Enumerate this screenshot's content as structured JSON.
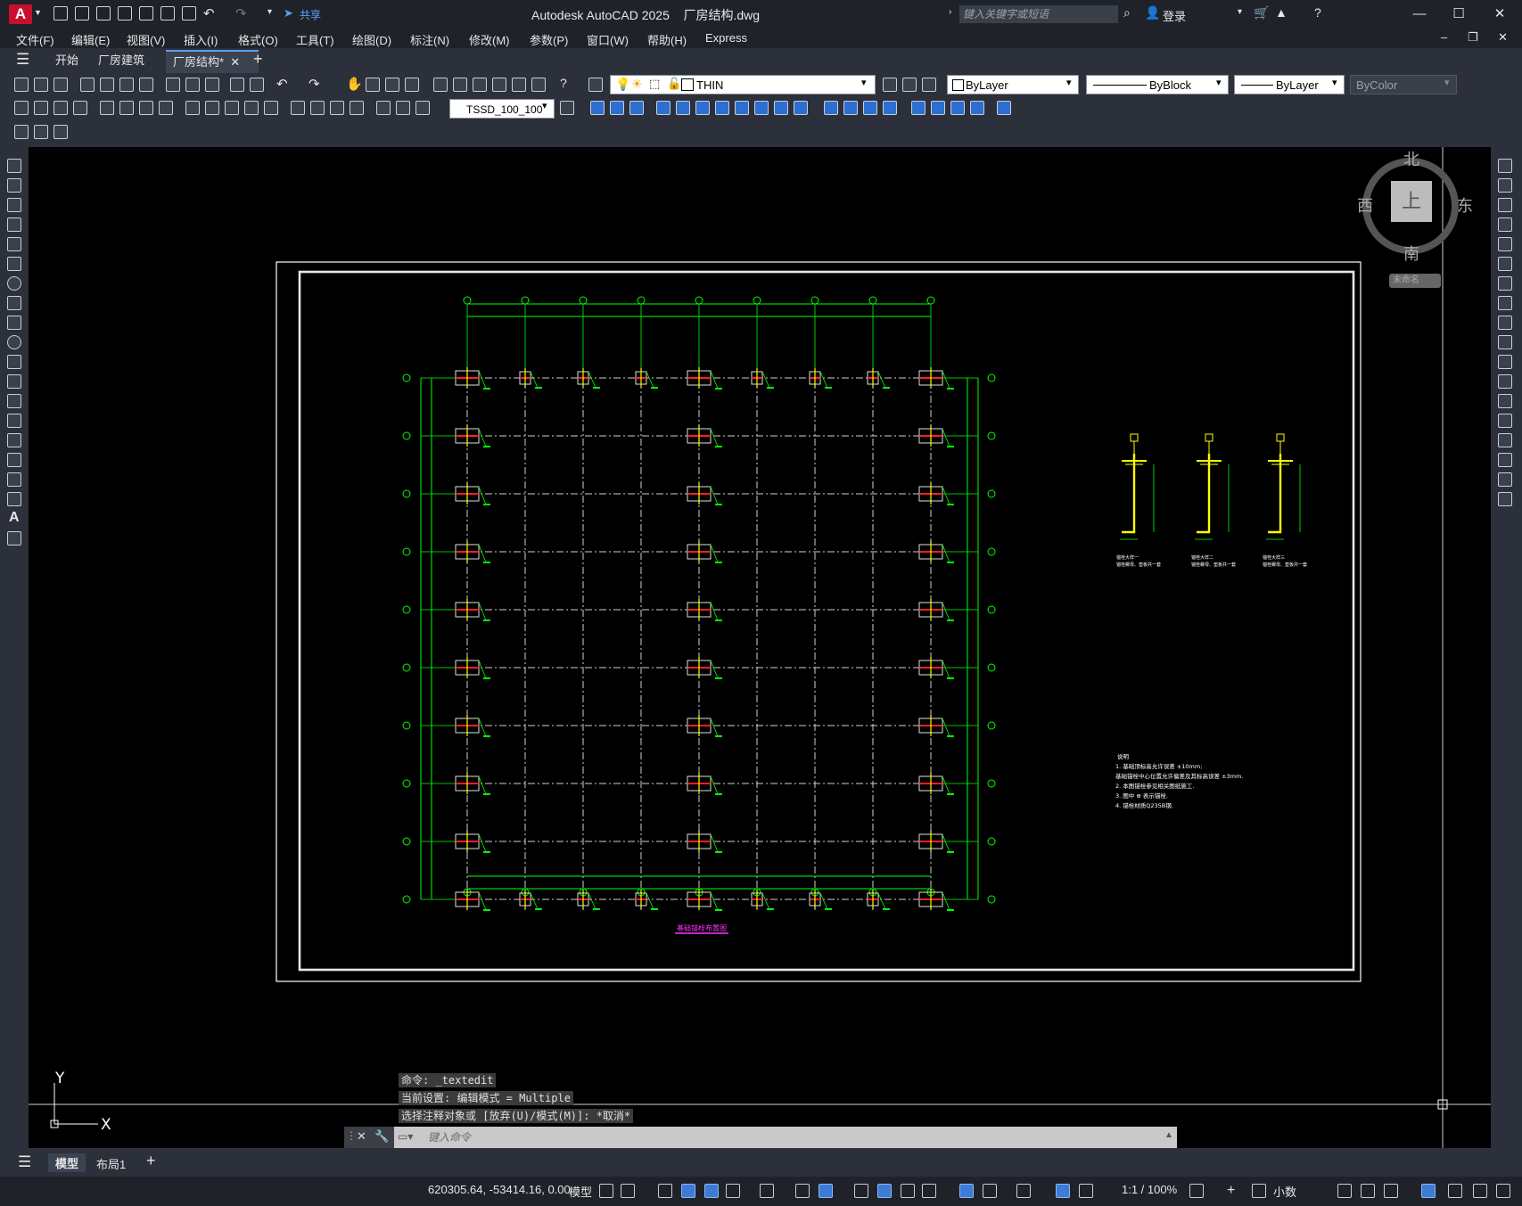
{
  "titlebar": {
    "app_logo": "A",
    "share_label": "共享",
    "title": "Autodesk AutoCAD 2025",
    "filename": "厂房结构.dwg",
    "search_placeholder": "键入关键字或短语",
    "login_label": "登录"
  },
  "menu": [
    "文件(F)",
    "编辑(E)",
    "视图(V)",
    "插入(I)",
    "格式(O)",
    "工具(T)",
    "绘图(D)",
    "标注(N)",
    "修改(M)",
    "参数(P)",
    "窗口(W)",
    "帮助(H)",
    "Express"
  ],
  "tabs": {
    "start": "开始",
    "doc1": "厂房建筑",
    "doc2": "厂房结构*"
  },
  "toolbar": {
    "layer_name": "THIN",
    "color": "ByLayer",
    "linetype": "ByBlock",
    "lineweight": "ByLayer",
    "plotstyle": "ByColor",
    "dimstyle": "TSSD_100_100"
  },
  "viewcube": {
    "north": "北",
    "south": "南",
    "east": "东",
    "west": "西",
    "face": "上",
    "wcs": "未命名"
  },
  "drawing": {
    "plan_title": "基础锚栓布置图",
    "notes_title": "说明",
    "notes": [
      "1. 基础顶标高允许误差 ±10mm;",
      "   基础锚栓中心位置允许偏差及其标高误差 ±3mm.",
      "2. 本图锚栓参见相关图纸施工.",
      "3. 图中 ⊕ 表示锚栓.",
      "4. 锚栓材质Q235B钢."
    ],
    "details": [
      {
        "caption": "锚栓大样一",
        "note": "锚栓螺母、垫板共一套"
      },
      {
        "caption": "锚栓大样二",
        "note": "锚栓螺母、垫板共一套"
      },
      {
        "caption": "锚栓大样三",
        "note": "锚栓螺母、垫板共一套"
      }
    ],
    "axis_y": "Y",
    "axis_x": "X"
  },
  "command": {
    "history": [
      "命令: _textedit",
      "当前设置: 编辑模式 = Multiple",
      "选择注释对象或 [放弃(U)/模式(M)]: *取消*"
    ],
    "placeholder": "键入命令"
  },
  "layout_tabs": {
    "model": "模型",
    "layout1": "布局1"
  },
  "status": {
    "coords": "620305.64, -53414.16, 0.00",
    "model": "模型",
    "scale": "1:1 / 100%",
    "units": "小数"
  },
  "colors": {
    "accent": "#5aa0ff",
    "grid_green": "#00ff00",
    "column_yellow": "#ffff00",
    "column_red": "#ff2020",
    "column_magenta": "#ff33ff",
    "logo_red": "#c8102e"
  }
}
